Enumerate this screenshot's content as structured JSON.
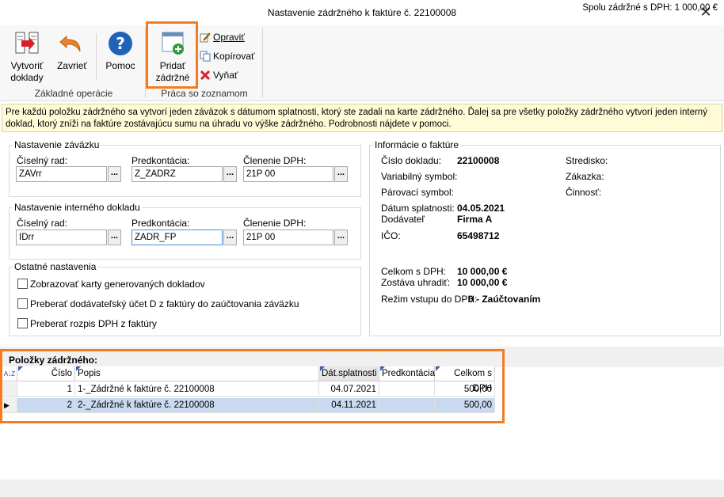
{
  "window": {
    "title": "Nastavenie zádržného k faktúre č. 22100008",
    "close_label": "✕"
  },
  "ribbon": {
    "create_docs_line1": "Vytvoriť",
    "create_docs_line2": "doklady",
    "close_line": "Zavrieť",
    "help_line": "Pomoc",
    "group_basic": "Základné operácie",
    "add_line1": "Pridať",
    "add_line2": "zádržné",
    "edit": "Opraviť",
    "copy": "Kopírovať",
    "remove": "Vyňať",
    "group_list": "Práca so zoznamom"
  },
  "info_text": "Pre každú položku zádržného sa vytvorí jeden záväzok s dátumom splatnosti, ktorý ste zadali na karte zádržného. Ďalej sa pre všetky položky zádržného vytvorí jeden interný doklad, ktorý zníži na faktúre zostávajúcu sumu na úhradu vo výške zádržného. Podrobnosti nájdete v pomoci.",
  "liability": {
    "legend": "Nastavenie záväzku",
    "series_label": "Číselný rad:",
    "series_value": "ZAVrr",
    "predkont_label": "Predkontácia:",
    "predkont_value": "Z_ZADRZ",
    "vat_label": "Členenie DPH:",
    "vat_value": "21P 00"
  },
  "internal": {
    "legend": "Nastavenie interného dokladu",
    "series_label": "Číselný rad:",
    "series_value": "IDrr",
    "predkont_label": "Predkontácia:",
    "predkont_value": "ZADR_FP",
    "vat_label": "Členenie DPH:",
    "vat_value": "21P 00"
  },
  "other": {
    "legend": "Ostatné nastavenia",
    "opt1": "Zobrazovať karty generovaných dokladov",
    "opt2": "Preberať dodávateľský účet D z faktúry do zaúčtovania záväzku",
    "opt3": "Preberať rozpis DPH z faktúry"
  },
  "invoice": {
    "legend": "Informácie o faktúre",
    "doc_no_label": "Číslo dokladu:",
    "doc_no_value": "22100008",
    "var_sym_label": "Variabilný symbol:",
    "pair_sym_label": "Párovací symbol:",
    "due_label": "Dátum splatnosti:",
    "due_value": "04.05.2021",
    "supplier_label": "Dodávateľ",
    "supplier_value": "Firma A",
    "ico_label": "IČO:",
    "ico_value": "65498712",
    "total_label": "Celkom s DPH:",
    "total_value": "10 000,00 €",
    "remain_label": "Zostáva uhradiť:",
    "remain_value": "10 000,00 €",
    "mode_label": "Režim vstupu do DPH:",
    "mode_value": "0 - Zaúčtovaním",
    "center_label": "Stredisko:",
    "order_label": "Zákazka:",
    "activity_label": "Činnosť:"
  },
  "grid": {
    "title": "Položky zádržného:",
    "sort_glyph": "A↓Z",
    "columns": [
      "Číslo",
      "Popis",
      "Dát.splatnosti",
      "Predkontácia",
      "Celkom s DPH"
    ],
    "rows": [
      {
        "num": "1",
        "desc": "1-_Zádržné k faktúre č. 22100008",
        "due": "04.07.2021",
        "predkont": "",
        "total": "500,00"
      },
      {
        "num": "2",
        "desc": "2-_Zádržné k faktúre č. 22100008",
        "due": "04.11.2021",
        "predkont": "",
        "total": "500,00"
      }
    ],
    "current_row_marker": "▶"
  },
  "status": {
    "sum_text": "Spolu zádržné s DPH: 1 000,00 €"
  },
  "colors": {
    "accent_orange": "#f47b20",
    "info_bg": "#fefbd6",
    "selected_row": "#c9d9ef"
  }
}
